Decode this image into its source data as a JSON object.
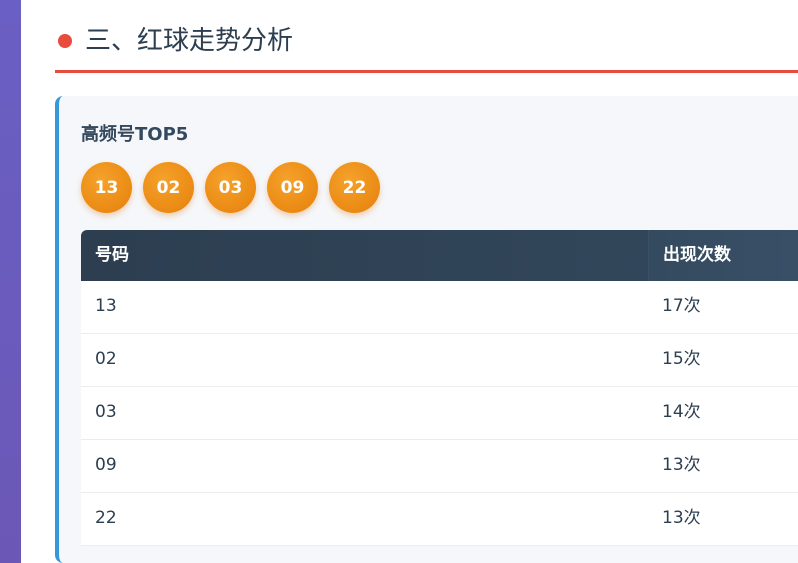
{
  "section": {
    "title": "三、红球走势分析"
  },
  "top5": {
    "subtitle": "高频号TOP5",
    "balls": [
      "13",
      "02",
      "03",
      "09",
      "22"
    ]
  },
  "table": {
    "headers": [
      "号码",
      "出现次数"
    ],
    "rows": [
      {
        "number": "13",
        "count": "17次"
      },
      {
        "number": "02",
        "count": "15次"
      },
      {
        "number": "03",
        "count": "14次"
      },
      {
        "number": "09",
        "count": "13次"
      },
      {
        "number": "22",
        "count": "13次"
      }
    ]
  },
  "colors": {
    "accent_red": "#e74c3c",
    "accent_blue": "#3498db",
    "ball_orange": "#ea8a14",
    "header_dark": "#2c3e50"
  }
}
